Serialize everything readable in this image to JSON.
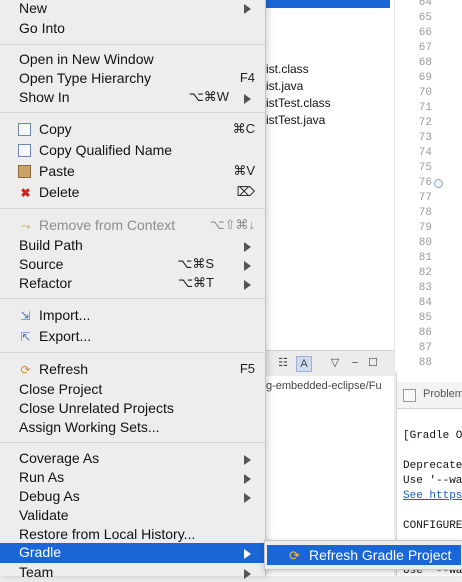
{
  "explorer": {
    "files": [
      "ist.class",
      "ist.java",
      "istTest.class",
      "istTest.java"
    ]
  },
  "editor": {
    "line_numbers": [
      "64",
      "65",
      "66",
      "67",
      "68",
      "69",
      "70",
      "71",
      "72",
      "73",
      "74",
      "75",
      "76",
      "77",
      "78",
      "79",
      "80",
      "81",
      "82",
      "83",
      "84",
      "85",
      "86",
      "87",
      "88"
    ]
  },
  "path_bar": {
    "text": "g-embedded-eclipse/Fu"
  },
  "problems_tab": {
    "label": "Problem"
  },
  "console": {
    "lines": [
      "[Gradle Ope",
      "Deprecate",
      "Use '--wa",
      "See https",
      "CONFIGURE",
      "Use '--wa"
    ]
  },
  "context_menu": {
    "new": "New",
    "go_into": "Go Into",
    "open_in_new_window": "Open in New Window",
    "open_type_hierarchy": "Open Type Hierarchy",
    "open_type_hierarchy_shortcut": "F4",
    "show_in": "Show In",
    "show_in_shortcut": "⌥⌘W",
    "copy": "Copy",
    "copy_shortcut": "⌘C",
    "copy_qualified_name": "Copy Qualified Name",
    "paste": "Paste",
    "paste_shortcut": "⌘V",
    "delete": "Delete",
    "delete_shortcut": "⌦",
    "remove_from_context": "Remove from Context",
    "remove_from_context_shortcut": "⌥⇧⌘↓",
    "build_path": "Build Path",
    "source": "Source",
    "source_shortcut": "⌥⌘S",
    "refactor": "Refactor",
    "refactor_shortcut": "⌥⌘T",
    "import": "Import...",
    "export": "Export...",
    "refresh": "Refresh",
    "refresh_shortcut": "F5",
    "close_project": "Close Project",
    "close_unrelated_projects": "Close Unrelated Projects",
    "assign_working_sets": "Assign Working Sets...",
    "coverage_as": "Coverage As",
    "run_as": "Run As",
    "debug_as": "Debug As",
    "validate": "Validate",
    "restore_from_local_history": "Restore from Local History...",
    "gradle": "Gradle",
    "team": "Team"
  },
  "gradle_submenu": {
    "refresh_gradle_project": "Refresh Gradle Project"
  },
  "colors": {
    "highlight": "#1a66d6",
    "menu_bg": "#ededed"
  }
}
